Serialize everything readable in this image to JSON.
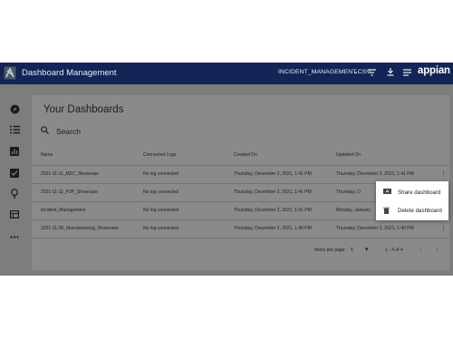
{
  "topbar": {
    "title": "Dashboard Management",
    "file_select": "INCIDENT_MANAGEMENT.CSV",
    "brand": "appian",
    "colors": {
      "bar": "#132456",
      "brand": "#ffffff"
    }
  },
  "sidebar": {
    "icons": [
      "compass-icon",
      "list-icon",
      "chart-icon",
      "checklist-icon",
      "lightbulb-icon",
      "table-icon",
      "more-horizontal-icon"
    ]
  },
  "main": {
    "title": "Your Dashboards",
    "search_label": "Search",
    "columns": [
      "Name",
      "Connected Logs",
      "Created On",
      "Updated On"
    ],
    "rows": [
      {
        "name": "2021-11-11_M2C_Showcase",
        "logs": "No log connected",
        "created": "Thursday, December 2, 2021, 1:41 PM",
        "updated": "Thursday, December 2, 2021, 1:41 PM"
      },
      {
        "name": "2021-11-11_P2P_Showcase",
        "logs": "No log connected",
        "created": "Thursday, December 2, 2021, 1:41 PM",
        "updated": "Thursday, D"
      },
      {
        "name": "Incident_Management",
        "logs": "No log connected",
        "created": "Thursday, December 2, 2021, 1:41 PM",
        "updated": "Monday, January"
      },
      {
        "name": "2021-11-26_Manufacturing_Showcase",
        "logs": "No log connected",
        "created": "Thursday, December 2, 2021, 1:40 PM",
        "updated": "Thursday, December 2, 2021, 1:40 PM"
      }
    ],
    "footer": {
      "items_per_page_label": "Items per page:",
      "items_per_page_value": "5",
      "range": "1 - 4 of 4"
    }
  },
  "context_menu": {
    "items": [
      {
        "label": "Share dashboard",
        "icon": "share-screen-icon"
      },
      {
        "label": "Delete dashboard",
        "icon": "trash-icon"
      }
    ]
  }
}
